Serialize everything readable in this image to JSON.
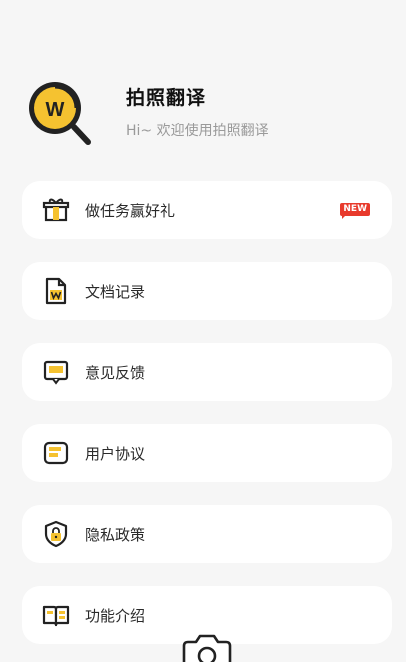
{
  "header": {
    "title": "拍照翻译",
    "subtitle": "Hi~ 欢迎使用拍照翻译",
    "logo_letter": "W",
    "logo_icon": "magnifier-logo-icon"
  },
  "menu": [
    {
      "label": "做任务赢好礼",
      "icon": "gift-icon",
      "badge": "NEW"
    },
    {
      "label": "文档记录",
      "icon": "document-icon"
    },
    {
      "label": "意见反馈",
      "icon": "feedback-icon"
    },
    {
      "label": "用户协议",
      "icon": "agreement-icon"
    },
    {
      "label": "隐私政策",
      "icon": "privacy-shield-icon"
    },
    {
      "label": "功能介绍",
      "icon": "book-icon"
    }
  ],
  "bottom": {
    "icon": "camera-icon"
  },
  "colors": {
    "accent": "#f5c230",
    "dark": "#222222",
    "badge": "#e83a2c",
    "background": "#f6f6f6"
  }
}
